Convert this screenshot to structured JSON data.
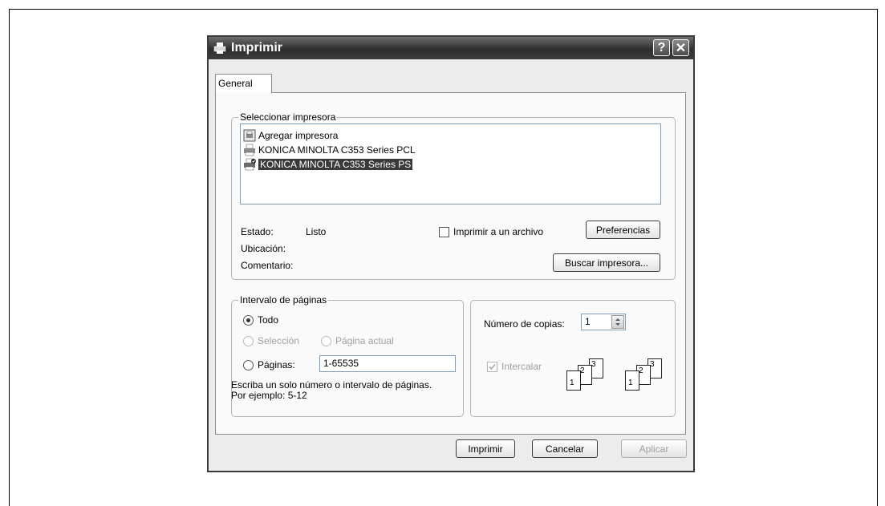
{
  "dialog": {
    "title": "Imprimir",
    "help_glyph": "?",
    "close_glyph": "✕"
  },
  "tabs": [
    {
      "label": "General"
    }
  ],
  "select_printer": {
    "legend": "Seleccionar impresora",
    "printers": [
      {
        "label": "Agregar impresora",
        "icon": "add-printer-icon"
      },
      {
        "label": "KONICA MINOLTA C353 Series PCL",
        "icon": "printer-icon"
      },
      {
        "label": "KONICA MINOLTA C353 Series PS",
        "icon": "printer-default-icon",
        "selected": true
      }
    ],
    "status_label": "Estado:",
    "status_value": "Listo",
    "location_label": "Ubicación:",
    "comment_label": "Comentario:",
    "print_to_file_label": "Imprimir a un archivo",
    "print_to_file_checked": false,
    "preferences_button": "Preferencias",
    "find_printer_button": "Buscar impresora..."
  },
  "page_range": {
    "legend": "Intervalo de páginas",
    "all_label": "Todo",
    "all_selected": true,
    "selection_label": "Selección",
    "current_page_label": "Página actual",
    "pages_label": "Páginas:",
    "pages_value": "1-65535",
    "hint": "Escriba un solo número o intervalo de páginas. Por ejemplo: 5-12"
  },
  "copies": {
    "label": "Número de copias:",
    "value": "1",
    "collate_label": "Intercalar",
    "collate_checked": true,
    "collate_glyphs": [
      "1",
      "2",
      "3",
      "1",
      "2",
      "3"
    ]
  },
  "footer": {
    "print_button": "Imprimir",
    "cancel_button": "Cancelar",
    "apply_button": "Aplicar"
  }
}
